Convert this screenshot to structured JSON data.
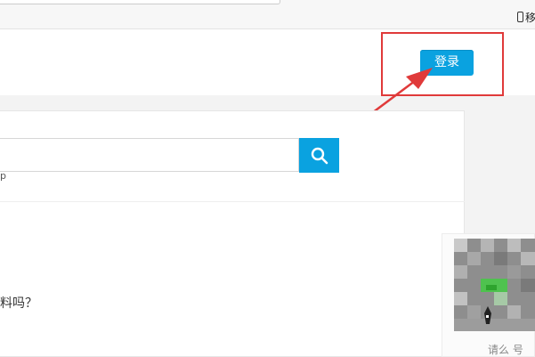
{
  "topbar": {
    "mobile_label": "移",
    "icon": "phone-icon"
  },
  "header": {
    "login_label": "登录"
  },
  "search": {
    "placeholder": "",
    "icon": "search-icon",
    "fragment": "p"
  },
  "content": {
    "question": "料吗？"
  },
  "qr_panel": {
    "caption": "请么 号"
  },
  "colors": {
    "accent": "#0aa2e0",
    "annotation": "#e03a3a"
  }
}
